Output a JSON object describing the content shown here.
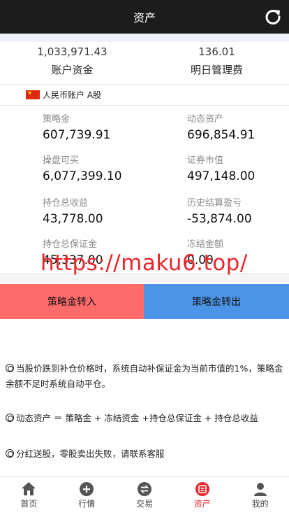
{
  "header": {
    "title": "资产",
    "refresh_icon": "refresh-icon"
  },
  "summary": {
    "funds_value": "1,033,971.43",
    "funds_label": "账户资金",
    "fee_value": "136.01",
    "fee_label": "明日管理费"
  },
  "account": {
    "flag_icon": "china-flag-icon",
    "label": "人民币账户 A股"
  },
  "stats": [
    {
      "label": "策略金",
      "value": "607,739.91"
    },
    {
      "label": "动态资产",
      "value": "696,854.91"
    },
    {
      "label": "操盘可买",
      "value": "6,077,399.10"
    },
    {
      "label": "证券市值",
      "value": "497,148.00"
    },
    {
      "label": "持仓总收益",
      "value": "43,778.00"
    },
    {
      "label": "历史结算盈亏",
      "value": "-53,874.00"
    },
    {
      "label": "持仓总保证金",
      "value": "45,337.00"
    },
    {
      "label": "冻结金额",
      "value": "0.00"
    }
  ],
  "watermark": "https://maku6.top/",
  "buttons": {
    "transfer_in": "策略金转入",
    "transfer_out": "策略金转出"
  },
  "notes": [
    "当股价跌到补仓价格时，系统自动补保证金为当前市值的1%，策略金余额不足时系统自动平仓。",
    "动态资产 ＝ 策略金 + 冻结资金 +持仓总保证金 + 持仓总收益",
    "分红送股，零股卖出失败，请联系客服"
  ],
  "tabs": [
    {
      "label": "首页",
      "icon": "home-icon"
    },
    {
      "label": "行情",
      "icon": "plus-circle-icon"
    },
    {
      "label": "交易",
      "icon": "exchange-icon"
    },
    {
      "label": "资产",
      "icon": "wallet-icon",
      "active": true
    },
    {
      "label": "我的",
      "icon": "user-icon"
    }
  ],
  "colors": {
    "accent": "#e8262b",
    "transfer_in_bg": "#ff6b6b",
    "transfer_out_bg": "#4c95e6",
    "header_bg": "#1c1c1c"
  }
}
